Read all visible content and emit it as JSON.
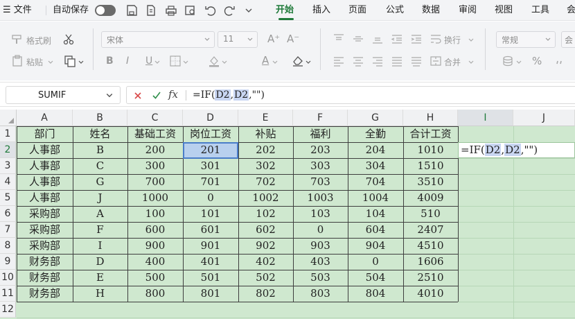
{
  "menubar": {
    "file_label": "文件",
    "autosave_label": "自动保存",
    "tabs": [
      "开始",
      "插入",
      "页面",
      "公式",
      "数据",
      "审阅",
      "视图",
      "工具",
      "会"
    ],
    "active_tab": "开始"
  },
  "ribbon": {
    "format_painter": "格式刷",
    "paste": "粘贴",
    "font_name": "宋体",
    "font_size": "11",
    "wrap": "换行",
    "merge": "合并",
    "number_format": "常规"
  },
  "formula_bar": {
    "name_box": "SUMIF",
    "formula_prefix": "=IF(",
    "ref1": "D2",
    "sep": ",",
    "ref2": "D2",
    "formula_suffix": ",\"\")"
  },
  "grid": {
    "columns": [
      "A",
      "B",
      "C",
      "D",
      "E",
      "F",
      "G",
      "H",
      "I",
      "J"
    ],
    "rows": [
      "1",
      "2",
      "3",
      "4",
      "5",
      "6",
      "7",
      "8",
      "9",
      "10",
      "11",
      "12"
    ],
    "header": [
      "部门",
      "姓名",
      "基础工资",
      "岗位工资",
      "补贴",
      "福利",
      "全勤",
      "合计工资"
    ],
    "data": [
      [
        "人事部",
        "B",
        "200",
        "201",
        "202",
        "203",
        "204",
        "1010"
      ],
      [
        "人事部",
        "C",
        "300",
        "301",
        "302",
        "303",
        "304",
        "1510"
      ],
      [
        "人事部",
        "G",
        "700",
        "701",
        "702",
        "703",
        "704",
        "3510"
      ],
      [
        "人事部",
        "J",
        "1000",
        "0",
        "1002",
        "1003",
        "1004",
        "4009"
      ],
      [
        "采购部",
        "A",
        "100",
        "101",
        "102",
        "103",
        "104",
        "510"
      ],
      [
        "采购部",
        "F",
        "600",
        "601",
        "602",
        "0",
        "604",
        "2407"
      ],
      [
        "采购部",
        "I",
        "900",
        "901",
        "902",
        "903",
        "904",
        "4510"
      ],
      [
        "财务部",
        "D",
        "400",
        "401",
        "402",
        "403",
        "0",
        "1606"
      ],
      [
        "财务部",
        "E",
        "500",
        "501",
        "502",
        "503",
        "504",
        "2510"
      ],
      [
        "财务部",
        "H",
        "800",
        "801",
        "802",
        "803",
        "804",
        "4010"
      ]
    ],
    "selected_column": "I",
    "selected_row": "2",
    "edit_cell": {
      "prefix": "=IF(",
      "ref1": "D2",
      "sep": ",",
      "ref2": "D2",
      "suffix": ",\"\")"
    }
  }
}
